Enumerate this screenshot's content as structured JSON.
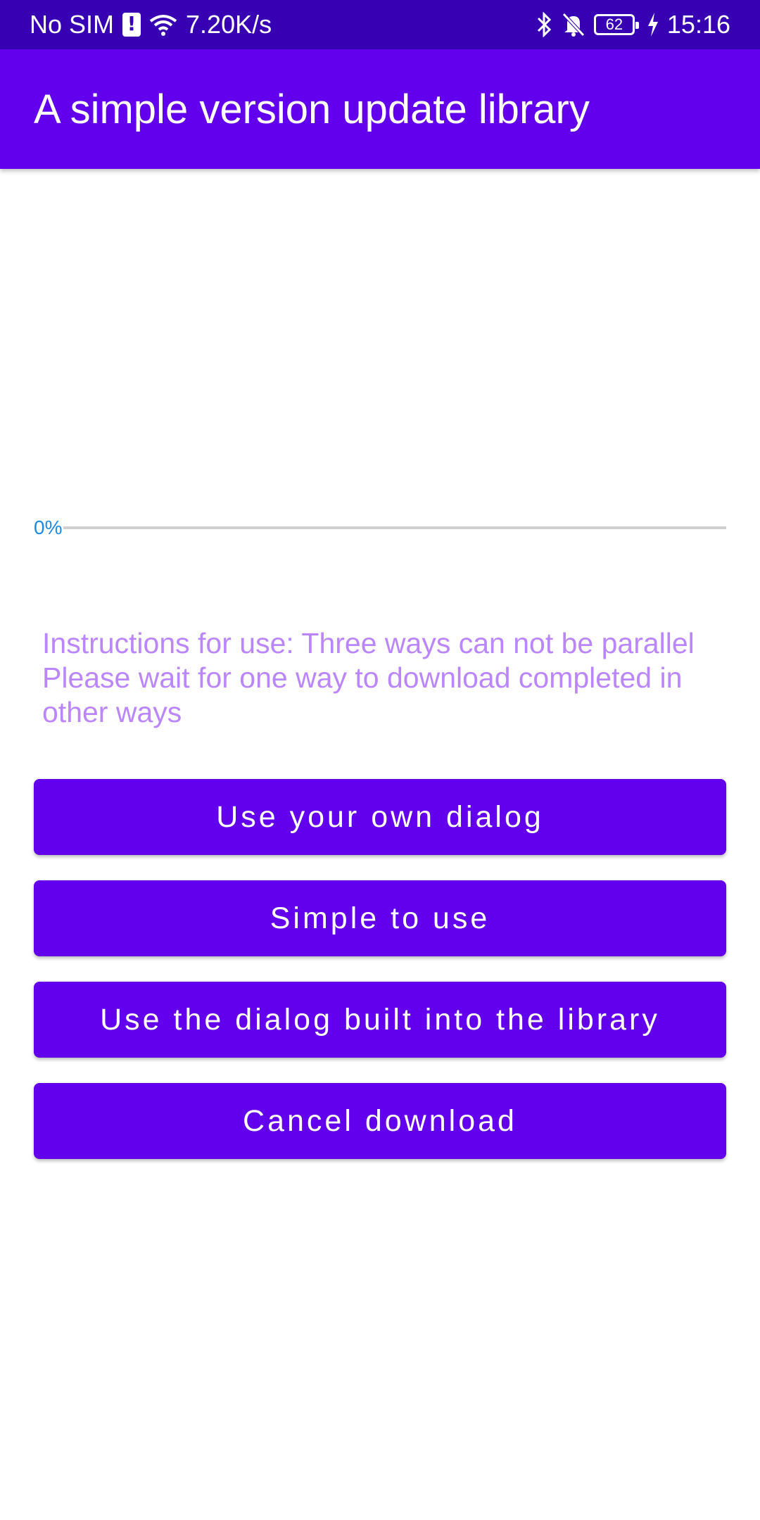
{
  "status_bar": {
    "carrier": "No SIM",
    "net_speed": "7.20K/s",
    "battery": "62",
    "time": "15:16"
  },
  "app_bar": {
    "title": "A simple version update library"
  },
  "progress": {
    "label": "0%",
    "value": 0
  },
  "instructions": {
    "line1": "Instructions for use: Three ways can not be parallel",
    "line2": "Please wait for one way to download completed in other ways"
  },
  "buttons": {
    "own_dialog": "Use your own dialog",
    "simple": "Simple to use",
    "builtin_dialog": "Use the dialog built into the library",
    "cancel": "Cancel download"
  },
  "colors": {
    "status_bar": "#3700b3",
    "primary": "#6200ee",
    "instructions_text": "#bb86fc",
    "progress_label": "#1e88e5"
  }
}
